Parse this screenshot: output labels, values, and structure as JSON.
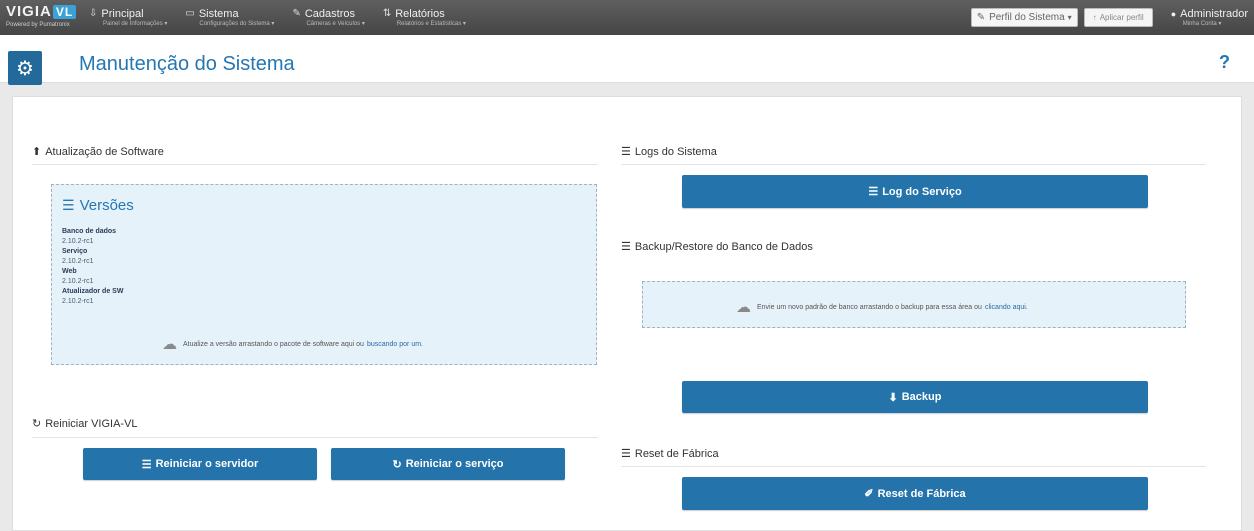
{
  "topbar": {
    "logo_main": "VIGIA",
    "logo_badge": "VL",
    "logo_sub": "Powered by Pumatronix",
    "nav": [
      {
        "icon": "⇩",
        "label": "Principal",
        "sub": "Painel de Informações ▾"
      },
      {
        "icon": "▭",
        "label": "Sistema",
        "sub": "Configurações do Sistema ▾"
      },
      {
        "icon": "✎",
        "label": "Cadastros",
        "sub": "Câmeras e Veículos ▾"
      },
      {
        "icon": "⇅",
        "label": "Relatórios",
        "sub": "Relatórios e Estatísticas ▾"
      }
    ],
    "profile_label": "Perfil do Sistema",
    "apply_label": "Aplicar perfil",
    "admin_label": "Administrador",
    "admin_sub": "Minha Conta ▾"
  },
  "header": {
    "title": "Manutenção do Sistema",
    "help": "?"
  },
  "software_update": {
    "heading": "Atualização de Software",
    "versions_title": "Versões",
    "versions": [
      {
        "label": "Banco de dados",
        "value": "2.10.2-rc1"
      },
      {
        "label": "Serviço",
        "value": "2.10.2-rc1"
      },
      {
        "label": "Web",
        "value": "2.10.2-rc1"
      },
      {
        "label": "Atualizador de SW",
        "value": "2.10.2-rc1"
      }
    ],
    "drop_text": "Atualize a versão arrastando o pacote de software aqui ou",
    "drop_link": "buscando por um."
  },
  "restart": {
    "heading": "Reiniciar VIGIA-VL",
    "server_button": "Reiniciar o servidor",
    "service_button": "Reiniciar o serviço"
  },
  "logs": {
    "heading": "Logs do Sistema",
    "service_log_button": "Log do Serviço"
  },
  "backup": {
    "heading": "Backup/Restore do Banco de Dados",
    "drop_text": "Envie um novo padrão de banco arrastando o backup para essa área ou",
    "drop_link": "clicando aqui.",
    "backup_button": "Backup"
  },
  "factory": {
    "heading": "Reset de Fábrica",
    "reset_button": "Reset de Fábrica"
  }
}
